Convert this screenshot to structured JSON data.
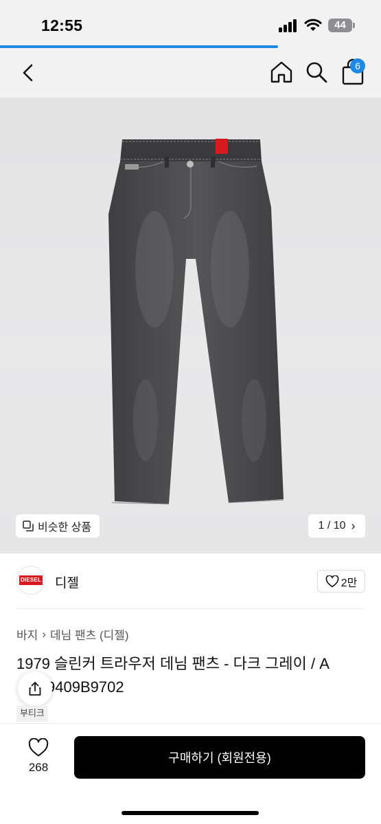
{
  "status_bar": {
    "time": "12:55",
    "battery": "44"
  },
  "page_load_progress": 0.73,
  "nav": {
    "cart_count": "6"
  },
  "gallery": {
    "similar_label": "비슷한 상품",
    "pager_text": "1 / 10",
    "pager_arrow": "›",
    "product_image": "dark gray slim denim jeans",
    "image_logo_text": "DIESEL"
  },
  "brand": {
    "name": "디젤",
    "logo_text": "DIESEL",
    "like_count": "2만"
  },
  "breadcrumb": {
    "items": [
      "바지",
      "데님 팬츠 (디젤)"
    ],
    "separator": "›"
  },
  "product": {
    "title_line1": "1979 슬린커 트라우저 데님 팬츠 - 다크 그레이 / A",
    "title_line2": "9409B9702",
    "tag": "부티크"
  },
  "bottom_bar": {
    "wish_count": "268",
    "buy_label": "구매하기 (회원전용)"
  },
  "colors": {
    "accent": "#1e88e5",
    "brand_red": "#d71920",
    "denim": "#4a4a4c",
    "buy_button": "#000000"
  }
}
